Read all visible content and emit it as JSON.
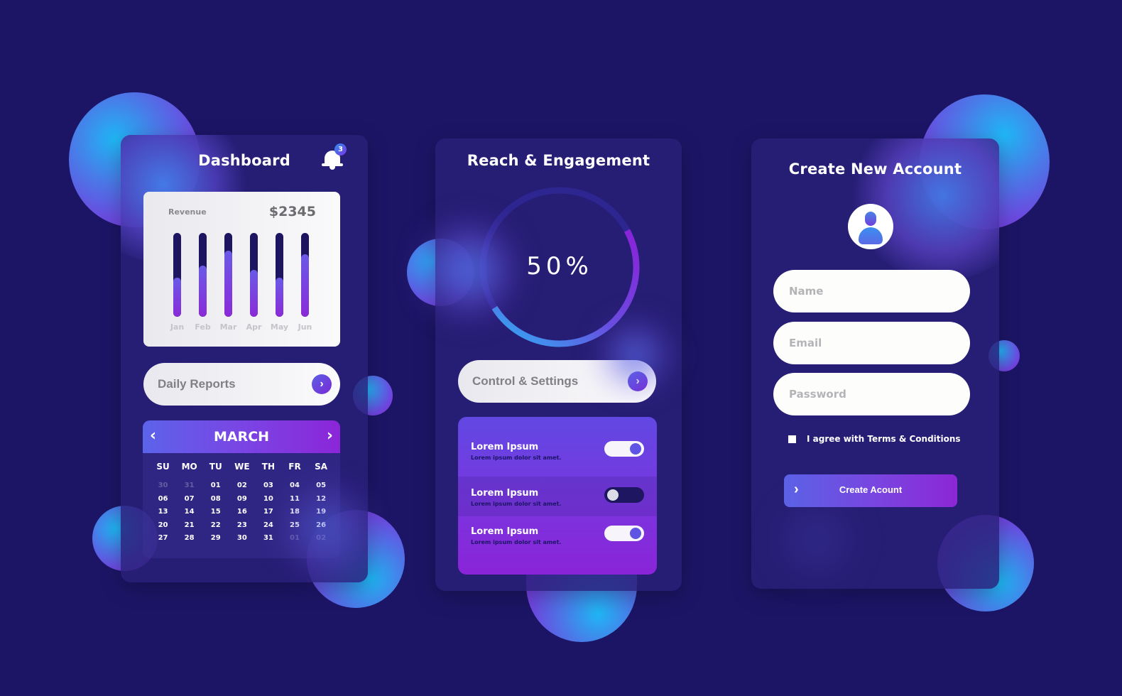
{
  "theme": {
    "background": "#1c1566",
    "accent_blue": "#1fb7f5",
    "accent_purple": "#8a22d8",
    "accent_indigo": "#5b62e6"
  },
  "dashboard": {
    "title": "Dashboard",
    "notification_icon": "bell-icon",
    "notification_count": "3",
    "revenue": {
      "label": "Revenue",
      "value": "$2345"
    },
    "daily_reports_label": "Daily Reports",
    "daily_reports_icon": "chevron-right-icon",
    "calendar": {
      "month": "MARCH",
      "prev_icon": "‹",
      "next_icon": "›",
      "weekdays": [
        "SU",
        "MO",
        "TU",
        "WE",
        "TH",
        "FR",
        "SA"
      ],
      "weeks": [
        [
          {
            "d": "30",
            "m": true
          },
          {
            "d": "31",
            "m": true
          },
          {
            "d": "01"
          },
          {
            "d": "02"
          },
          {
            "d": "03"
          },
          {
            "d": "04"
          },
          {
            "d": "05"
          }
        ],
        [
          {
            "d": "06"
          },
          {
            "d": "07"
          },
          {
            "d": "08"
          },
          {
            "d": "09"
          },
          {
            "d": "10"
          },
          {
            "d": "11"
          },
          {
            "d": "12"
          }
        ],
        [
          {
            "d": "13"
          },
          {
            "d": "14"
          },
          {
            "d": "15"
          },
          {
            "d": "16"
          },
          {
            "d": "17"
          },
          {
            "d": "18"
          },
          {
            "d": "19"
          }
        ],
        [
          {
            "d": "20"
          },
          {
            "d": "21"
          },
          {
            "d": "22"
          },
          {
            "d": "23"
          },
          {
            "d": "24"
          },
          {
            "d": "25"
          },
          {
            "d": "26"
          }
        ],
        [
          {
            "d": "27"
          },
          {
            "d": "28"
          },
          {
            "d": "29"
          },
          {
            "d": "30"
          },
          {
            "d": "31"
          },
          {
            "d": "01",
            "m": true
          },
          {
            "d": "02",
            "m": true
          }
        ]
      ]
    }
  },
  "chart_data": {
    "type": "bar",
    "title": "Revenue",
    "categories": [
      "Jan",
      "Feb",
      "Mar",
      "Apr",
      "May",
      "Jun"
    ],
    "values": [
      47,
      61,
      79,
      56,
      47,
      75
    ],
    "ylim": [
      0,
      100
    ],
    "xlabel": "",
    "ylabel": "",
    "grid": false,
    "note": "values are relative fill percentages of each bar track; total shown as $2345"
  },
  "reach": {
    "title": "Reach & Engagement",
    "progress_percent": 50,
    "progress_label": "50%",
    "control_label": "Control & Settings",
    "control_icon": "chevron-right-icon",
    "settings": [
      {
        "title": "Lorem Ipsum",
        "subtitle": "Lorem ipsum dolor sit amet.",
        "enabled": true
      },
      {
        "title": "Lorem Ipsum",
        "subtitle": "Lorem ipsum dolor sit amet.",
        "enabled": false
      },
      {
        "title": "Lorem Ipsum",
        "subtitle": "Lorem ipsum dolor sit amet.",
        "enabled": true
      }
    ]
  },
  "signup": {
    "title": "Create New Account",
    "avatar_icon": "user-icon",
    "fields": {
      "name": {
        "placeholder": "Name",
        "value": ""
      },
      "email": {
        "placeholder": "Email",
        "value": ""
      },
      "password": {
        "placeholder": "Password",
        "value": ""
      }
    },
    "agree_label": "I agree with Terms & Conditions",
    "agree_checked": false,
    "submit_label": "Create Acount",
    "submit_icon": "›"
  }
}
